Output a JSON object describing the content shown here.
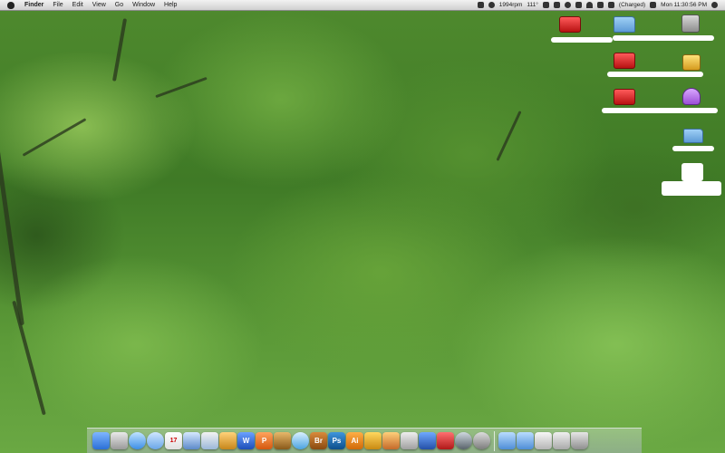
{
  "menubar": {
    "app_name": "Finder",
    "items": [
      "File",
      "Edit",
      "View",
      "Go",
      "Window",
      "Help"
    ],
    "fan_speed": "1994rpm",
    "temperature": "111°",
    "battery": "(Charged)",
    "clock": "Mon 11:30:56 PM"
  },
  "dock": {
    "photoshop_label": "Ps",
    "illustrator_label": "Ai",
    "bridge_label": "Br",
    "calendar_day": "17",
    "word_label": "W",
    "powerpoint_label": "P"
  },
  "colors": {
    "photoshop": "#1b6fb3",
    "illustrator": "#e8790f",
    "bridge": "#b5651d"
  }
}
